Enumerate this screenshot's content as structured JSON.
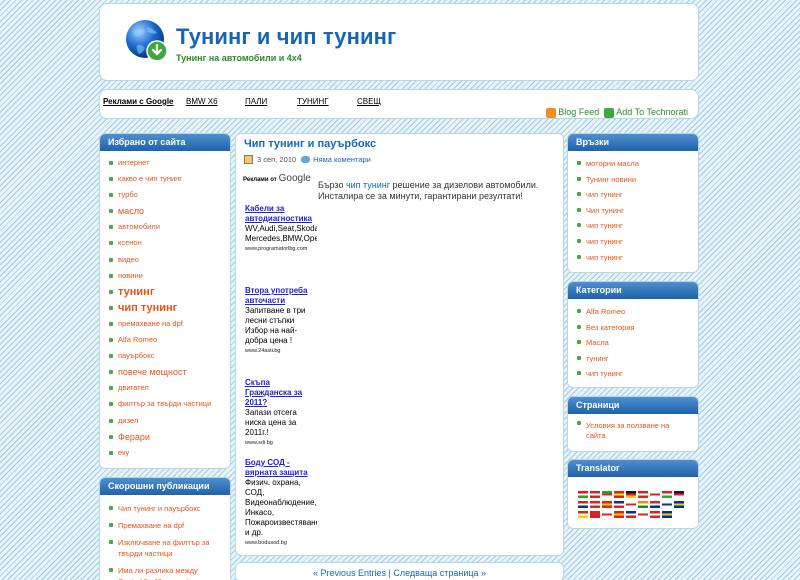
{
  "header": {
    "title": "Тунинг и чип тунинг",
    "tagline": "Тунинг на автомобили и 4x4"
  },
  "nav": {
    "ads_label": "Реклами с Google",
    "links": [
      "BMW X6",
      "ПАЛИ",
      "ТУНИНГ",
      "СВЕЩ"
    ],
    "blog_feed": "Blog Feed",
    "technorati": "Add To Technorati"
  },
  "favorites": {
    "title": "Избрано от сайта",
    "items": [
      {
        "label": "интернет",
        "size": "sm"
      },
      {
        "label": "какво е чип тунинг",
        "size": "sm"
      },
      {
        "label": "турбо",
        "size": "sm"
      },
      {
        "label": "масло",
        "size": "lg"
      },
      {
        "label": "автомобили",
        "size": "sm"
      },
      {
        "label": "ксенон",
        "size": "sm"
      },
      {
        "label": "видео",
        "size": "sm"
      },
      {
        "label": "новини",
        "size": "sm"
      },
      {
        "label": "тунинг",
        "size": "xl"
      },
      {
        "label": "чип тунинг",
        "size": "xl"
      },
      {
        "label": "премахване на dpf",
        "size": "sm"
      },
      {
        "label": "Alfa Romeo",
        "size": "sm"
      },
      {
        "label": "пауърбокс",
        "size": "sm"
      },
      {
        "label": "повече мощност",
        "size": "lg"
      },
      {
        "label": "двигател",
        "size": "sm"
      },
      {
        "label": "филтър за твърди частици",
        "size": "sm"
      },
      {
        "label": "дизел",
        "size": "sm"
      },
      {
        "label": "Ферари",
        "size": "lg"
      },
      {
        "label": "еку",
        "size": "sm"
      }
    ]
  },
  "recent": {
    "title": "Скорошни публикации",
    "items": [
      "Чип тунинг и пауърбокс",
      "Премахване на dpf",
      "Изключване на филтър за твърди частици",
      "Има ли разлика между Castrol 5w40 magnatec с"
    ]
  },
  "post": {
    "title": "Чип тунинг и пауърбокс",
    "date": "3 сеп, 2010",
    "comments": "Няма коментари",
    "ads_label_small": "Реклами от",
    "ads_label_google": "Google",
    "text_before": "Бързо ",
    "text_keyword": "чип тунинг",
    "text_after": " решение за дизелови автомобили. Инсталира се за минути, гарантирани резултати!",
    "ads": [
      {
        "title": "Кабели за автодиагностика",
        "desc": "WV,Audi,Seat,Skoda\nMercedes,BMW,Opel",
        "url": "www.programatorlbg.com"
      },
      {
        "title": "Втора употреба авточасти",
        "desc": "Запитване в три лесни стъпки\nИзбор на най-добра цена !",
        "url": "www.24asti.bg"
      },
      {
        "title": "Скъпа Гражданска за 2011?",
        "desc": "Запази отсега ниска цена за 2011г.!",
        "url": "www.sdi.bg"
      },
      {
        "title": "Боду СОД - вярната защита",
        "desc": "Физич. охрана, СОД, Видеонаблюдение, Инкасо, Пожароизвестяване и др.",
        "url": "www.bodusod.bg"
      }
    ]
  },
  "pager": {
    "prev": "« Previous Entries",
    "sep": "|",
    "next": "Следваща страница »"
  },
  "links": {
    "title": "Връзки",
    "items": [
      "моторни масла",
      "Тунинг новини",
      "чип тунинг",
      "Чип тунинг",
      "чип тунинг",
      "чип тунинг",
      "чип тунинг"
    ]
  },
  "categories": {
    "title": "Категории",
    "items": [
      "Alfa Romeo",
      "Без категория",
      "Масла",
      "тунинг",
      "чип тунинг"
    ]
  },
  "pages": {
    "title": "Страници",
    "items": [
      "Условия за ползване на сайта"
    ]
  },
  "translator": {
    "title": "Translator",
    "flag_colors": [
      [
        "#e12",
        "#fff",
        "#2a2"
      ],
      [
        "#d22",
        "#fff",
        "#d22"
      ],
      [
        "#1a3",
        "#e22",
        "#fff"
      ],
      [
        "#d22",
        "#ee2",
        "#d22"
      ],
      [
        "#111",
        "#d22",
        "#fc0"
      ],
      [
        "#d22",
        "#fff",
        "#d22"
      ],
      [
        "#fff",
        "#d22",
        "#fff"
      ],
      [
        "#d22",
        "#fff",
        "#2a4"
      ],
      [
        "#115",
        "#d22",
        "#fff"
      ],
      [
        "#d22",
        "#fff",
        "#039"
      ],
      [
        "#d22",
        "#fff",
        "#d22"
      ],
      [
        "#d22",
        "#fc0",
        "#d22"
      ],
      [
        "#039",
        "#fff",
        "#d22"
      ],
      [
        "#fff",
        "#d22",
        "#fff"
      ],
      [
        "#f80",
        "#fff",
        "#183"
      ],
      [
        "#d22",
        "#fff",
        "#039"
      ],
      [
        "#fff",
        "#039",
        "#fff"
      ],
      [
        "#039",
        "#fc0",
        "#039"
      ],
      [
        "#d22",
        "#fff",
        "#fc0"
      ],
      [
        "#d22",
        "#d22",
        "#d22"
      ],
      [
        "#fff",
        "#d22",
        "#fff"
      ],
      [
        "#d22",
        "#fc0",
        "#d22"
      ],
      [
        "#039",
        "#fff",
        "#d22"
      ],
      [
        "#fff",
        "#d22",
        "#fff"
      ],
      [
        "#d22",
        "#fff",
        "#d22"
      ],
      [
        "#039",
        "#fc0",
        "#039"
      ]
    ]
  }
}
